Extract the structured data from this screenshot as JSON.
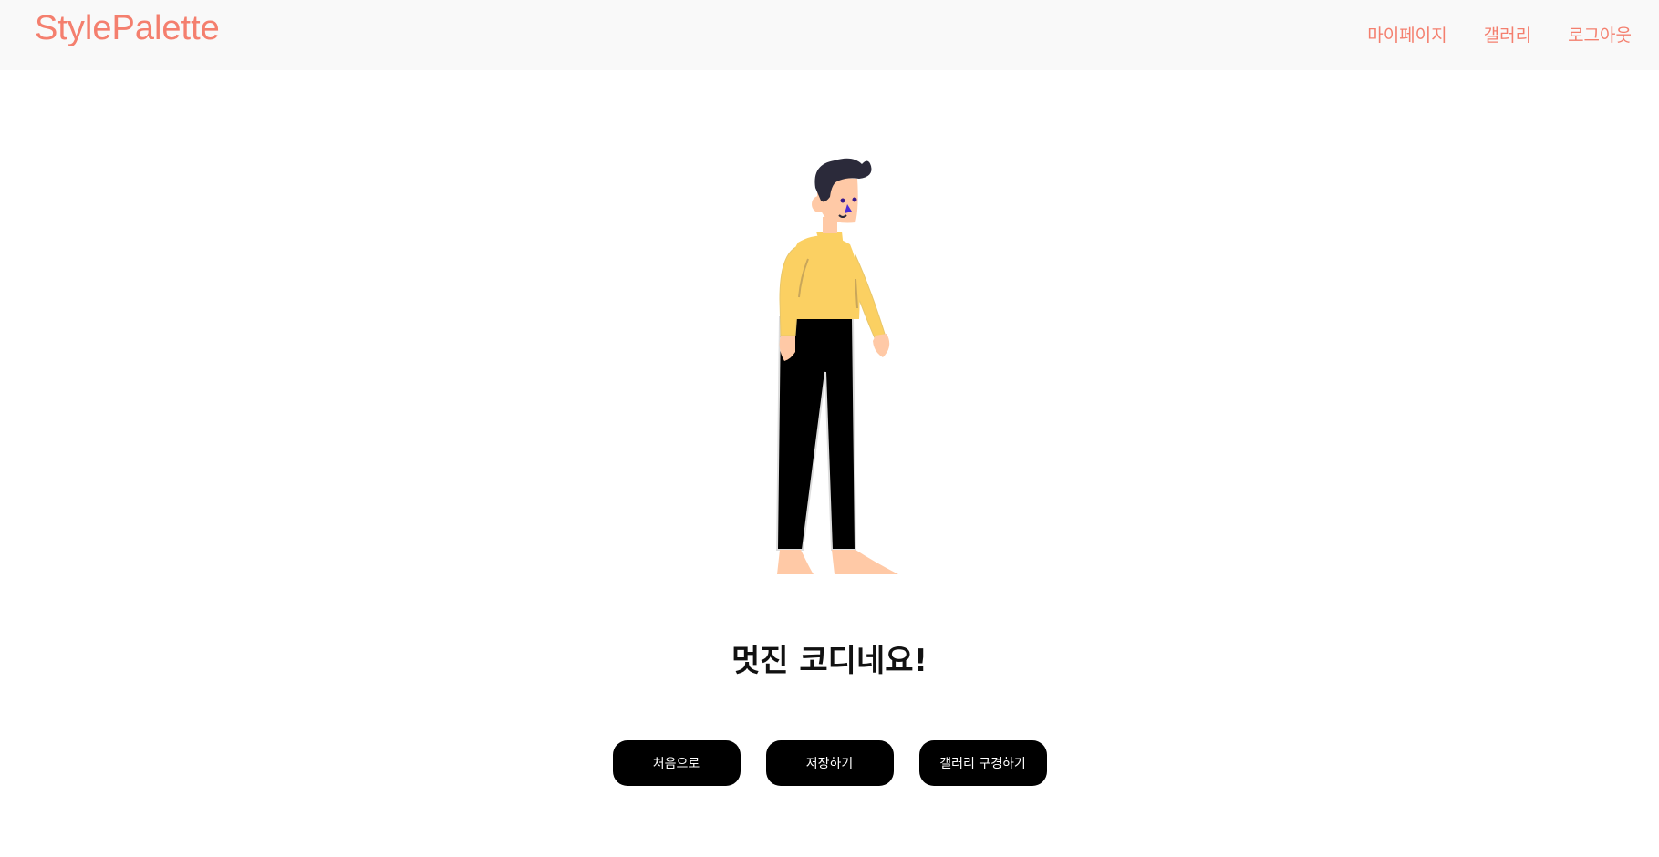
{
  "header": {
    "logo": "StylePalette",
    "nav": [
      {
        "label": "마이페이지"
      },
      {
        "label": "갤러리"
      },
      {
        "label": "로그아웃"
      }
    ]
  },
  "main": {
    "illustration": "person-illustration",
    "headline": "멋진 코디네요!",
    "buttons": [
      {
        "label": "처음으로"
      },
      {
        "label": "저장하기"
      },
      {
        "label": "갤러리 구경하기"
      }
    ]
  },
  "colors": {
    "brand": "#f47f6e",
    "header_bg": "#f9f9f9",
    "button_bg": "#000000",
    "button_text": "#ffffff",
    "sweater": "#fbd062",
    "pants": "#000000",
    "skin": "#ffc9a6",
    "hair": "#2b2a3a"
  }
}
